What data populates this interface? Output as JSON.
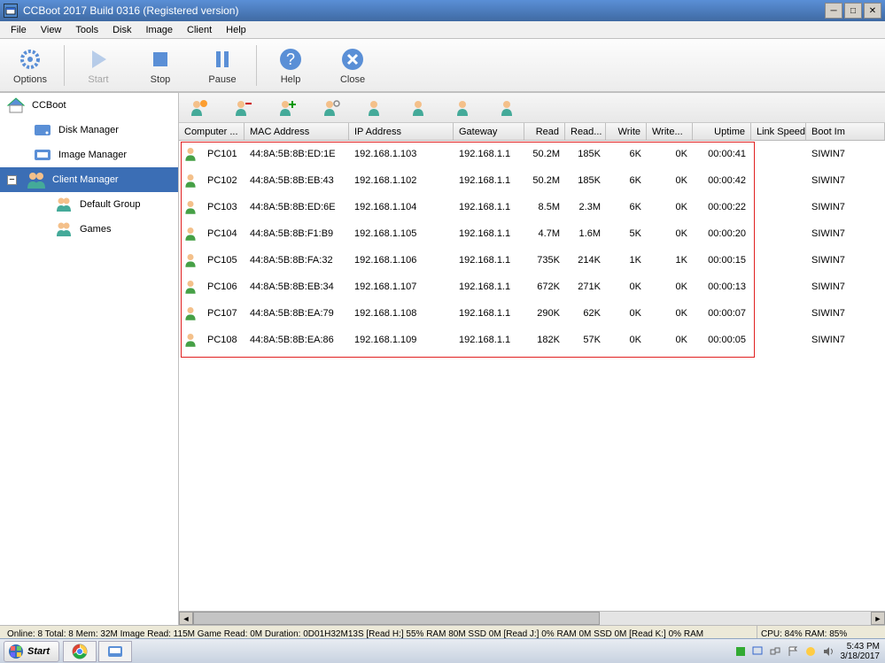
{
  "window": {
    "title": "CCBoot 2017 Build 0316 (Registered version)"
  },
  "menu": {
    "file": "File",
    "view": "View",
    "tools": "Tools",
    "disk": "Disk",
    "image": "Image",
    "client": "Client",
    "help": "Help"
  },
  "toolbar": {
    "options": "Options",
    "start": "Start",
    "stop": "Stop",
    "pause": "Pause",
    "help": "Help",
    "close": "Close"
  },
  "tree": {
    "root": "CCBoot",
    "disk_manager": "Disk Manager",
    "image_manager": "Image Manager",
    "client_manager": "Client Manager",
    "default_group": "Default Group",
    "games": "Games"
  },
  "columns": {
    "computer": "Computer ...",
    "mac": "MAC Address",
    "ip": "IP Address",
    "gateway": "Gateway",
    "read": "Read",
    "reads": "Read...",
    "write": "Write",
    "writes": "Write...",
    "uptime": "Uptime",
    "link": "Link Speed",
    "boot": "Boot Im"
  },
  "rows": [
    {
      "name": "PC101",
      "mac": "44:8A:5B:8B:ED:1E",
      "ip": "192.168.1.103",
      "gw": "192.168.1.1",
      "read": "50.2M",
      "reads": "185K",
      "write": "6K",
      "writes": "0K",
      "uptime": "00:00:41",
      "link": "",
      "boot": "SIWIN7"
    },
    {
      "name": "PC102",
      "mac": "44:8A:5B:8B:EB:43",
      "ip": "192.168.1.102",
      "gw": "192.168.1.1",
      "read": "50.2M",
      "reads": "185K",
      "write": "6K",
      "writes": "0K",
      "uptime": "00:00:42",
      "link": "",
      "boot": "SIWIN7"
    },
    {
      "name": "PC103",
      "mac": "44:8A:5B:8B:ED:6E",
      "ip": "192.168.1.104",
      "gw": "192.168.1.1",
      "read": "8.5M",
      "reads": "2.3M",
      "write": "6K",
      "writes": "0K",
      "uptime": "00:00:22",
      "link": "",
      "boot": "SIWIN7"
    },
    {
      "name": "PC104",
      "mac": "44:8A:5B:8B:F1:B9",
      "ip": "192.168.1.105",
      "gw": "192.168.1.1",
      "read": "4.7M",
      "reads": "1.6M",
      "write": "5K",
      "writes": "0K",
      "uptime": "00:00:20",
      "link": "",
      "boot": "SIWIN7"
    },
    {
      "name": "PC105",
      "mac": "44:8A:5B:8B:FA:32",
      "ip": "192.168.1.106",
      "gw": "192.168.1.1",
      "read": "735K",
      "reads": "214K",
      "write": "1K",
      "writes": "1K",
      "uptime": "00:00:15",
      "link": "",
      "boot": "SIWIN7"
    },
    {
      "name": "PC106",
      "mac": "44:8A:5B:8B:EB:34",
      "ip": "192.168.1.107",
      "gw": "192.168.1.1",
      "read": "672K",
      "reads": "271K",
      "write": "0K",
      "writes": "0K",
      "uptime": "00:00:13",
      "link": "",
      "boot": "SIWIN7"
    },
    {
      "name": "PC107",
      "mac": "44:8A:5B:8B:EA:79",
      "ip": "192.168.1.108",
      "gw": "192.168.1.1",
      "read": "290K",
      "reads": "62K",
      "write": "0K",
      "writes": "0K",
      "uptime": "00:00:07",
      "link": "",
      "boot": "SIWIN7"
    },
    {
      "name": "PC108",
      "mac": "44:8A:5B:8B:EA:86",
      "ip": "192.168.1.109",
      "gw": "192.168.1.1",
      "read": "182K",
      "reads": "57K",
      "write": "0K",
      "writes": "0K",
      "uptime": "00:00:05",
      "link": "",
      "boot": "SIWIN7"
    }
  ],
  "status": {
    "main": "Online: 8 Total: 8 Mem: 32M Image Read: 115M Game Read: 0M Duration: 0D01H32M13S [Read H:] 55% RAM 80M SSD 0M [Read J:] 0% RAM 0M SSD 0M [Read K:] 0% RAM",
    "cpu": "CPU: 84% RAM: 85%"
  },
  "taskbar": {
    "start": "Start",
    "time": "5:43 PM",
    "date": "3/18/2017"
  }
}
